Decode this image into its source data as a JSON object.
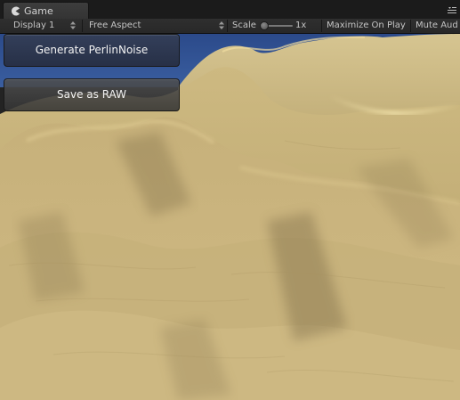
{
  "tab": {
    "title": "Game",
    "icon": "pacman-game-icon",
    "menu_icon": "tab-menu-icon"
  },
  "toolbar": {
    "display": "Display 1",
    "aspect": "Free Aspect",
    "scale_label": "Scale",
    "scale_value": "1x",
    "scale_level": 0,
    "maximize": "Maximize On Play",
    "mute": "Mute Aud"
  },
  "overlay": {
    "generate_button": "Generate PerlinNoise",
    "save_button": "Save as RAW"
  },
  "colors": {
    "terrain": "#c9b27c",
    "sky": "#2f4c86",
    "button": "#3a3a3a"
  }
}
